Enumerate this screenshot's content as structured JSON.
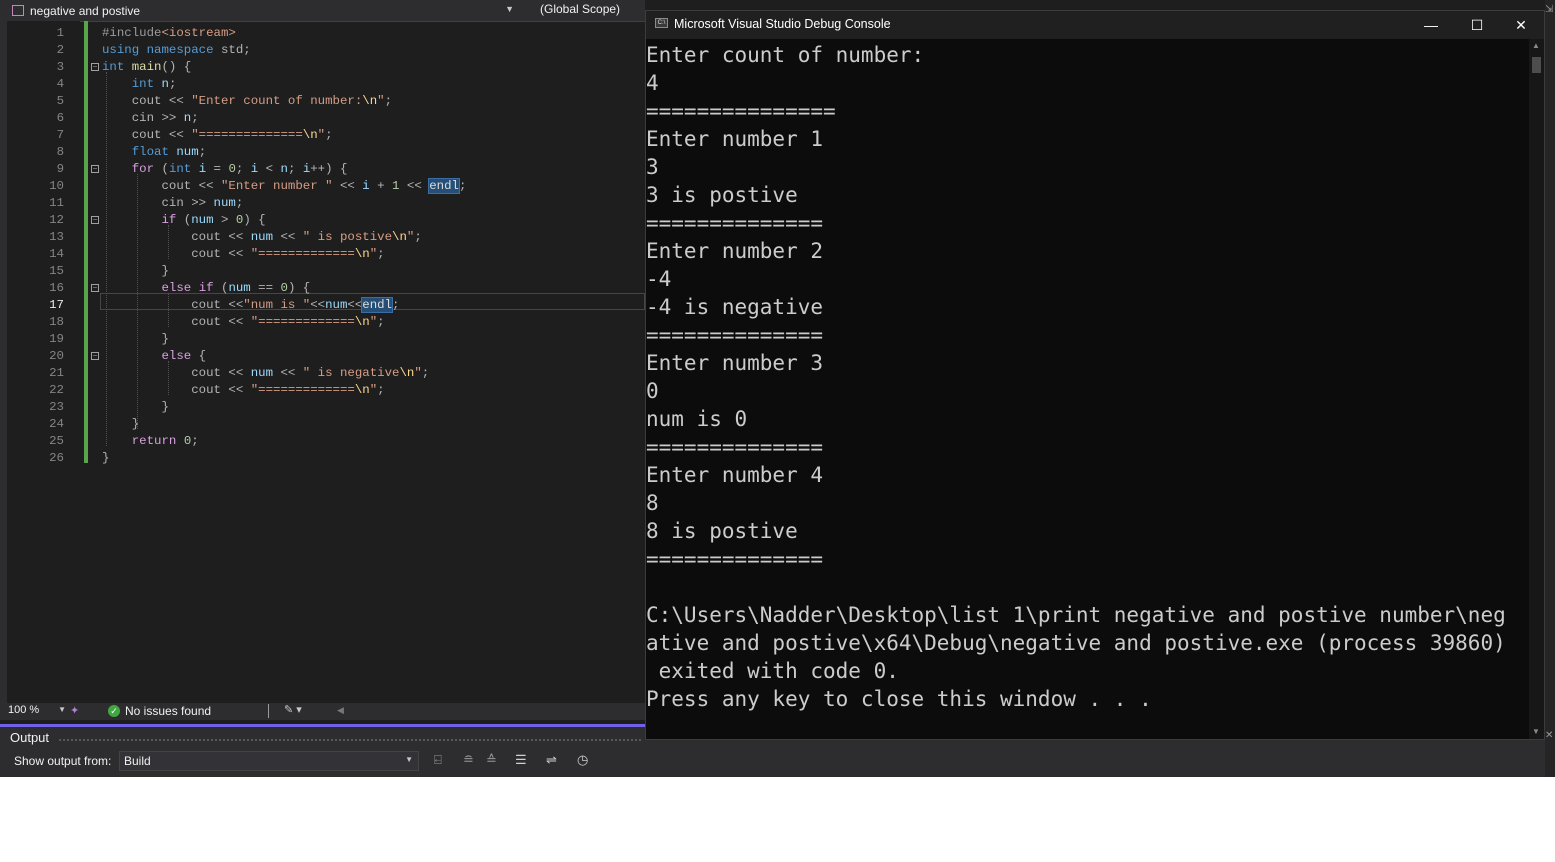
{
  "editor": {
    "file_dropdown": "negative and postive",
    "scope_dropdown": "(Global Scope)",
    "current_line": 17,
    "lines": [
      [
        [
          "pp",
          "#include"
        ],
        [
          "ppm",
          "<iostream>"
        ]
      ],
      [
        [
          "kw",
          "using"
        ],
        [
          "op",
          " "
        ],
        [
          "kw",
          "namespace"
        ],
        [
          "op",
          " std;"
        ]
      ],
      [
        [
          "ty",
          "int"
        ],
        [
          "op",
          " "
        ],
        [
          "fn",
          "main"
        ],
        [
          "op",
          "() {"
        ]
      ],
      [
        [
          "op",
          "    "
        ],
        [
          "ty",
          "int"
        ],
        [
          "op",
          " "
        ],
        [
          "var",
          "n"
        ],
        [
          "op",
          ";"
        ]
      ],
      [
        [
          "op",
          "    cout << "
        ],
        [
          "str",
          "\"Enter count of number:"
        ],
        [
          "esc",
          "\\n"
        ],
        [
          "str",
          "\""
        ],
        [
          "op",
          ";"
        ]
      ],
      [
        [
          "op",
          "    cin >> "
        ],
        [
          "var",
          "n"
        ],
        [
          "op",
          ";"
        ]
      ],
      [
        [
          "op",
          "    cout << "
        ],
        [
          "str",
          "\"=============="
        ],
        [
          "esc",
          "\\n"
        ],
        [
          "str",
          "\""
        ],
        [
          "op",
          ";"
        ]
      ],
      [
        [
          "op",
          "    "
        ],
        [
          "ty",
          "float"
        ],
        [
          "op",
          " "
        ],
        [
          "var",
          "num"
        ],
        [
          "op",
          ";"
        ]
      ],
      [
        [
          "op",
          "    "
        ],
        [
          "ctl",
          "for"
        ],
        [
          "op",
          " ("
        ],
        [
          "ty",
          "int"
        ],
        [
          "op",
          " "
        ],
        [
          "var",
          "i"
        ],
        [
          "op",
          " = "
        ],
        [
          "num",
          "0"
        ],
        [
          "op",
          "; "
        ],
        [
          "var",
          "i"
        ],
        [
          "op",
          " < "
        ],
        [
          "var",
          "n"
        ],
        [
          "op",
          "; "
        ],
        [
          "var",
          "i"
        ],
        [
          "op",
          "++) {"
        ]
      ],
      [
        [
          "op",
          "        cout << "
        ],
        [
          "str",
          "\"Enter number \""
        ],
        [
          "op",
          " << "
        ],
        [
          "var",
          "i"
        ],
        [
          "op",
          " + "
        ],
        [
          "num",
          "1"
        ],
        [
          "op",
          " << "
        ],
        [
          "hl",
          "endl"
        ],
        [
          "op",
          ";"
        ]
      ],
      [
        [
          "op",
          "        cin >> "
        ],
        [
          "var",
          "num"
        ],
        [
          "op",
          ";"
        ]
      ],
      [
        [
          "op",
          "        "
        ],
        [
          "ctl",
          "if"
        ],
        [
          "op",
          " ("
        ],
        [
          "var",
          "num"
        ],
        [
          "op",
          " > "
        ],
        [
          "num",
          "0"
        ],
        [
          "op",
          ") {"
        ]
      ],
      [
        [
          "op",
          "            cout << "
        ],
        [
          "var",
          "num"
        ],
        [
          "op",
          " << "
        ],
        [
          "str",
          "\" is postive"
        ],
        [
          "esc",
          "\\n"
        ],
        [
          "str",
          "\""
        ],
        [
          "op",
          ";"
        ]
      ],
      [
        [
          "op",
          "            cout << "
        ],
        [
          "str",
          "\"============="
        ],
        [
          "esc",
          "\\n"
        ],
        [
          "str",
          "\""
        ],
        [
          "op",
          ";"
        ]
      ],
      [
        [
          "op",
          "        }"
        ]
      ],
      [
        [
          "op",
          "        "
        ],
        [
          "ctl",
          "else"
        ],
        [
          "op",
          " "
        ],
        [
          "ctl",
          "if"
        ],
        [
          "op",
          " ("
        ],
        [
          "var",
          "num"
        ],
        [
          "op",
          " == "
        ],
        [
          "num",
          "0"
        ],
        [
          "op",
          ") {"
        ]
      ],
      [
        [
          "op",
          "            cout <<"
        ],
        [
          "str",
          "\"num is \""
        ],
        [
          "op",
          "<<"
        ],
        [
          "var",
          "num"
        ],
        [
          "op",
          "<<"
        ],
        [
          "hl",
          "endl"
        ],
        [
          "op",
          ";"
        ]
      ],
      [
        [
          "op",
          "            cout << "
        ],
        [
          "str",
          "\"============="
        ],
        [
          "esc",
          "\\n"
        ],
        [
          "str",
          "\""
        ],
        [
          "op",
          ";"
        ]
      ],
      [
        [
          "op",
          "        }"
        ]
      ],
      [
        [
          "op",
          "        "
        ],
        [
          "ctl",
          "else"
        ],
        [
          "op",
          " {"
        ]
      ],
      [
        [
          "op",
          "            cout << "
        ],
        [
          "var",
          "num"
        ],
        [
          "op",
          " << "
        ],
        [
          "str",
          "\" is negative"
        ],
        [
          "esc",
          "\\n"
        ],
        [
          "str",
          "\""
        ],
        [
          "op",
          ";"
        ]
      ],
      [
        [
          "op",
          "            cout << "
        ],
        [
          "str",
          "\"============="
        ],
        [
          "esc",
          "\\n"
        ],
        [
          "str",
          "\""
        ],
        [
          "op",
          ";"
        ]
      ],
      [
        [
          "op",
          "        }"
        ]
      ],
      [
        [
          "op",
          "    }"
        ]
      ],
      [
        [
          "op",
          "    "
        ],
        [
          "ctl",
          "return"
        ],
        [
          "op",
          " "
        ],
        [
          "num",
          "0"
        ],
        [
          "op",
          ";"
        ]
      ],
      [
        [
          "op",
          "}"
        ]
      ]
    ]
  },
  "status": {
    "zoom": "100 %",
    "issues": "No issues found"
  },
  "output": {
    "title": "Output",
    "show_from_label": "Show output from:",
    "source": "Build"
  },
  "console": {
    "title": "Microsoft Visual Studio Debug Console",
    "lines": [
      "Enter count of number:",
      "4",
      "===============",
      "Enter number 1",
      "3",
      "3 is postive",
      "==============",
      "Enter number 2",
      "-4",
      "-4 is negative",
      "==============",
      "Enter number 3",
      "0",
      "num is 0",
      "==============",
      "Enter number 4",
      "8",
      "8 is postive",
      "==============",
      "",
      "C:\\Users\\Nadder\\Desktop\\list 1\\print negative and postive number\\neg",
      "ative and postive\\x64\\Debug\\negative and postive.exe (process 39860)",
      " exited with code 0.",
      "Press any key to close this window . . ."
    ]
  }
}
